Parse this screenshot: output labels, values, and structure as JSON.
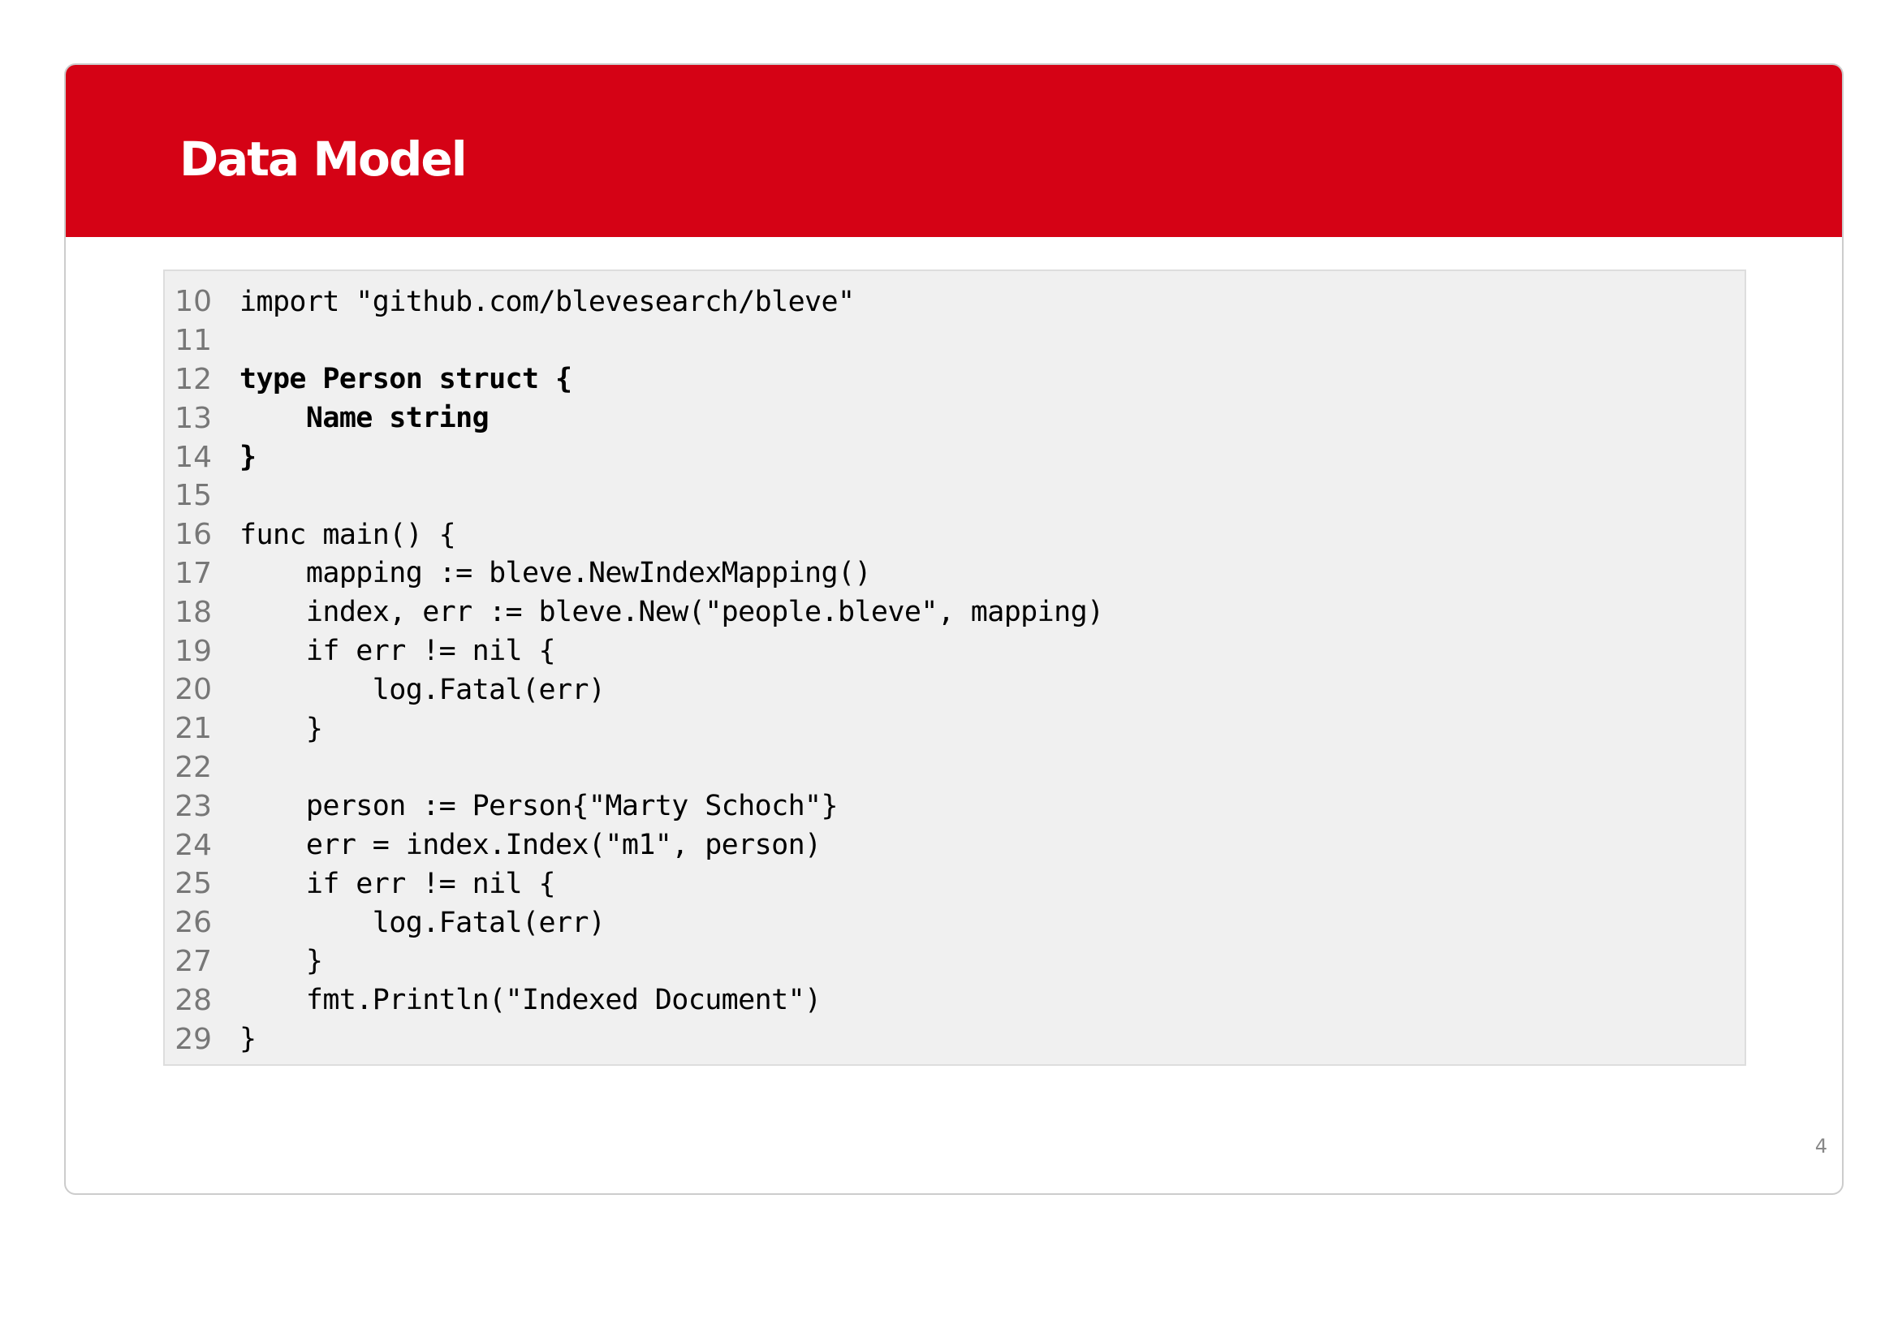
{
  "slide": {
    "title": "Data Model",
    "page_number": "4"
  },
  "code": {
    "lines": [
      {
        "num": "10",
        "text": "import \"github.com/blevesearch/bleve\"",
        "bold": false
      },
      {
        "num": "11",
        "text": "",
        "bold": false
      },
      {
        "num": "12",
        "text": "type Person struct {",
        "bold": true
      },
      {
        "num": "13",
        "text": "    Name string",
        "bold": true
      },
      {
        "num": "14",
        "text": "}",
        "bold": true
      },
      {
        "num": "15",
        "text": "",
        "bold": false
      },
      {
        "num": "16",
        "text": "func main() {",
        "bold": false
      },
      {
        "num": "17",
        "text": "    mapping := bleve.NewIndexMapping()",
        "bold": false
      },
      {
        "num": "18",
        "text": "    index, err := bleve.New(\"people.bleve\", mapping)",
        "bold": false
      },
      {
        "num": "19",
        "text": "    if err != nil {",
        "bold": false
      },
      {
        "num": "20",
        "text": "        log.Fatal(err)",
        "bold": false
      },
      {
        "num": "21",
        "text": "    }",
        "bold": false
      },
      {
        "num": "22",
        "text": "",
        "bold": false
      },
      {
        "num": "23",
        "text": "    person := Person{\"Marty Schoch\"}",
        "bold": false
      },
      {
        "num": "24",
        "text": "    err = index.Index(\"m1\", person)",
        "bold": false
      },
      {
        "num": "25",
        "text": "    if err != nil {",
        "bold": false
      },
      {
        "num": "26",
        "text": "        log.Fatal(err)",
        "bold": false
      },
      {
        "num": "27",
        "text": "    }",
        "bold": false
      },
      {
        "num": "28",
        "text": "    fmt.Println(\"Indexed Document\")",
        "bold": false
      },
      {
        "num": "29",
        "text": "}",
        "bold": false
      }
    ]
  },
  "colors": {
    "header_background": "#d50215",
    "header_text": "#ffffff",
    "code_background": "#f0f0f0",
    "line_number_text": "#777777"
  }
}
